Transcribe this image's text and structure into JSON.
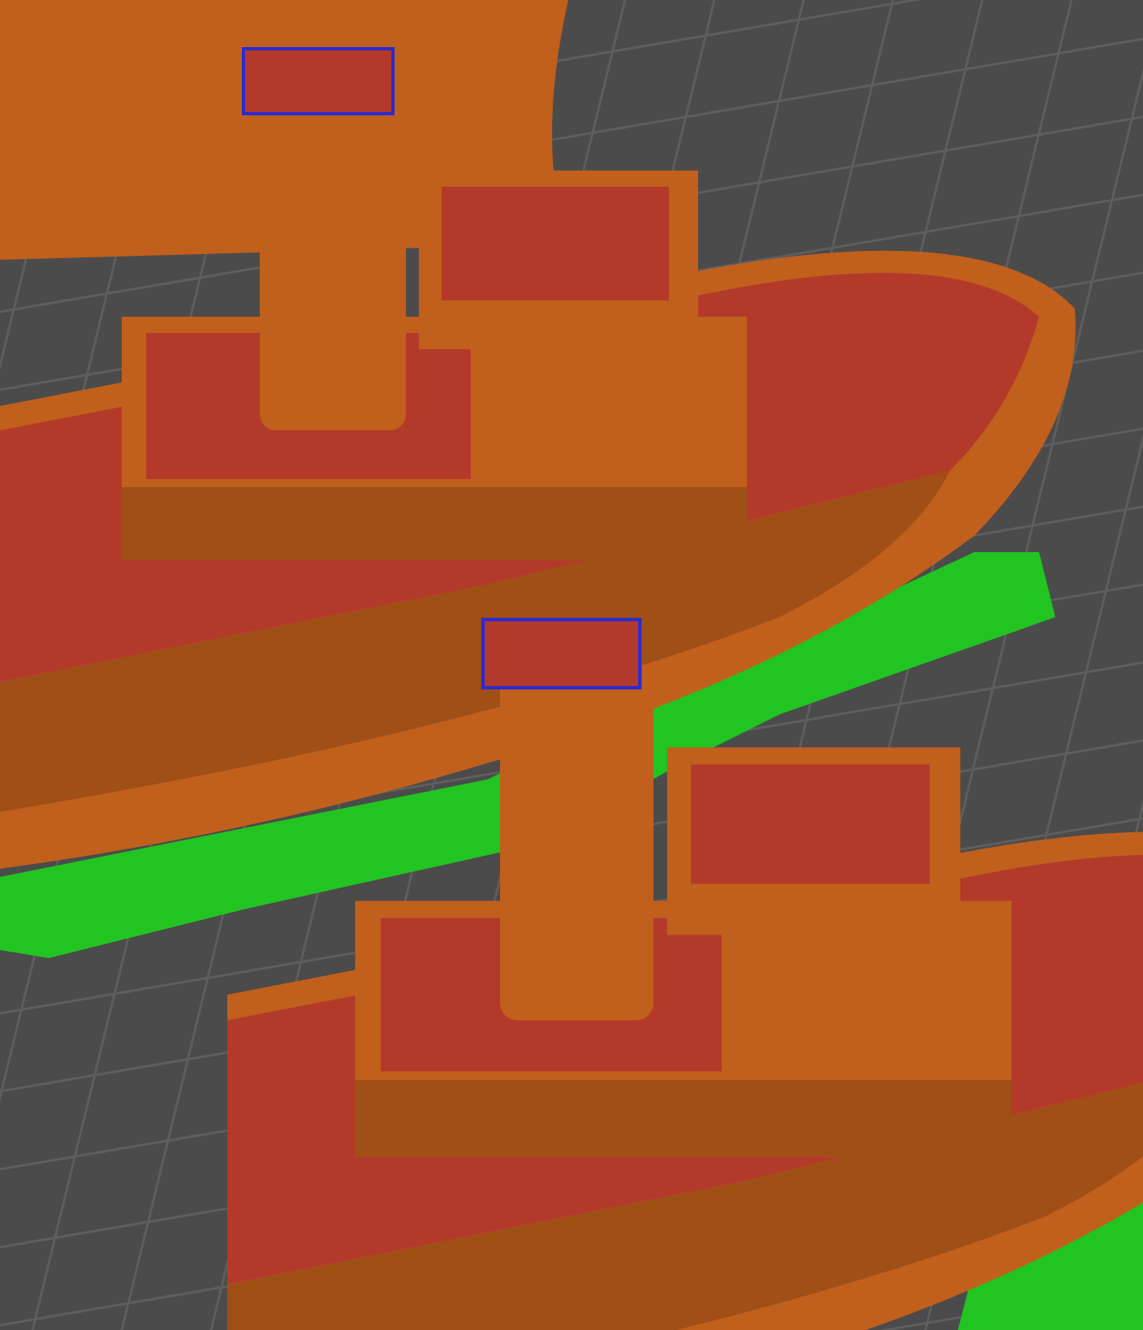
{
  "viewport": {
    "supports_shown": true
  }
}
